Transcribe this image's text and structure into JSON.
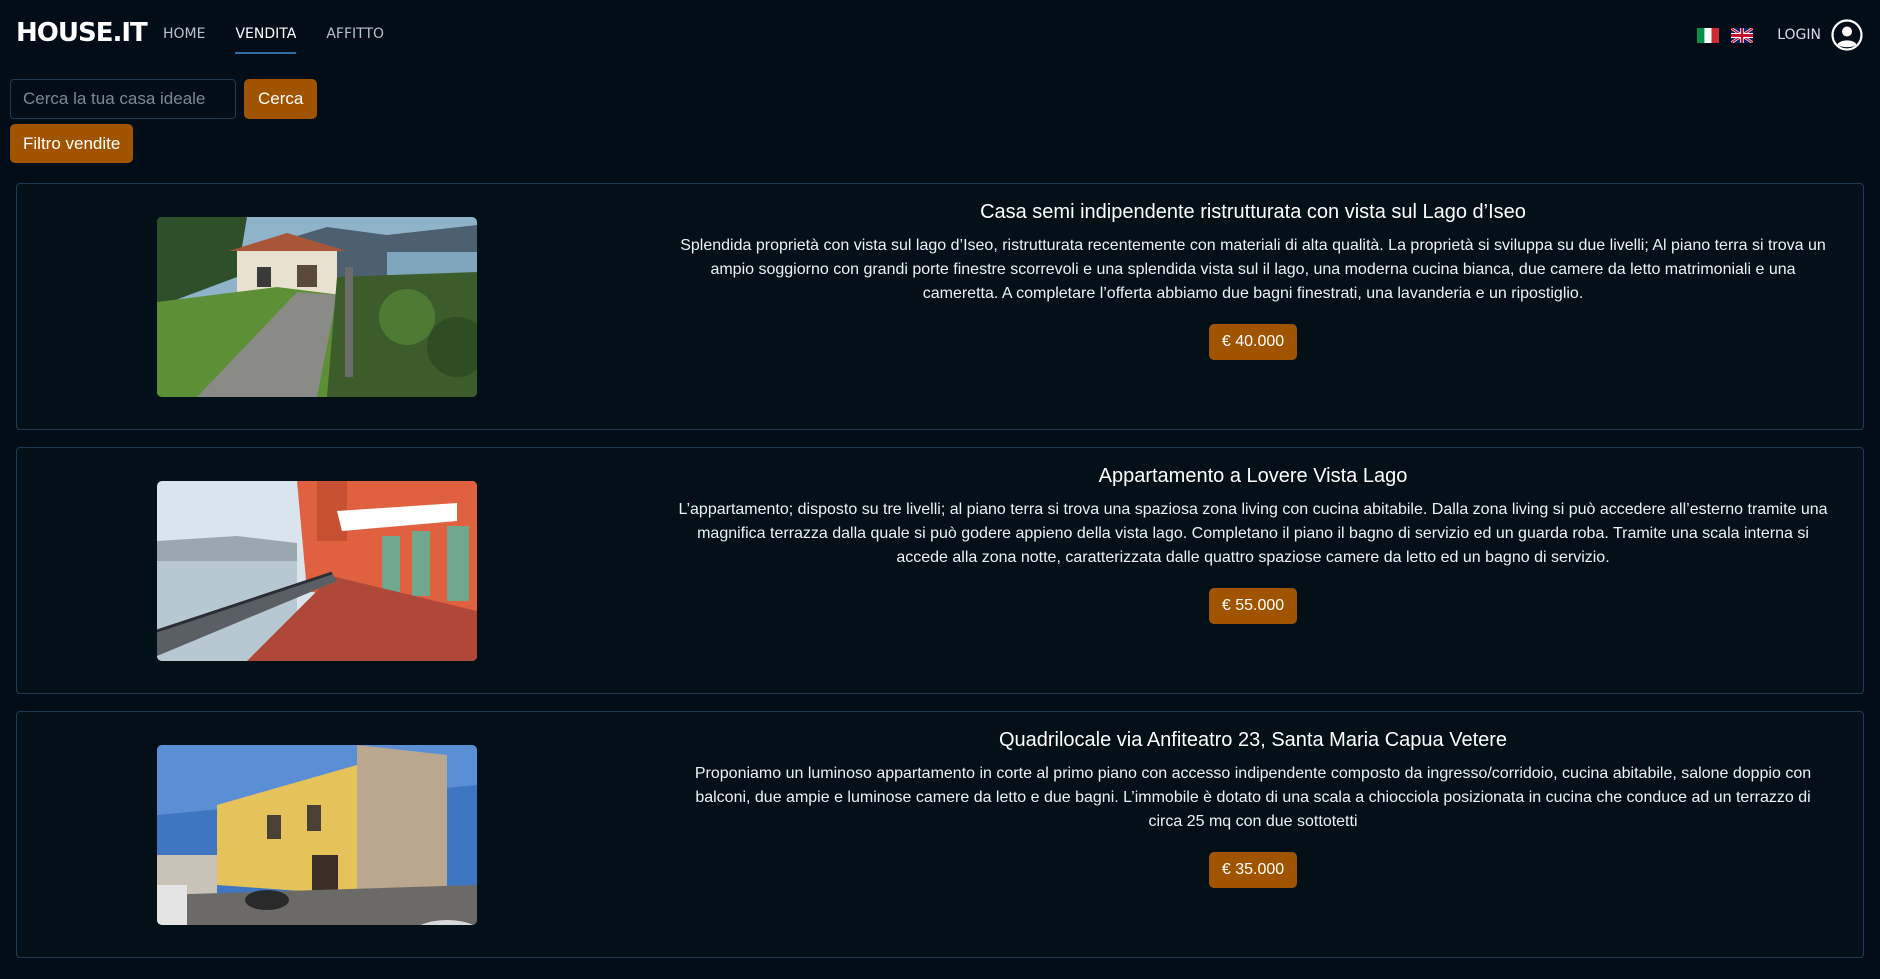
{
  "brand": "HOUSE.IT",
  "nav": {
    "items": [
      {
        "label": "HOME",
        "active": false
      },
      {
        "label": "VENDITA",
        "active": true
      },
      {
        "label": "AFFITTO",
        "active": false
      }
    ],
    "login_label": "LOGIN",
    "flags": [
      "italian-flag-icon",
      "uk-flag-icon"
    ],
    "user_icon": "user-circle-icon"
  },
  "search": {
    "placeholder": "Cerca la tua casa ideale",
    "value": "",
    "button_label": "Cerca"
  },
  "filter": {
    "button_label": "Filtro vendite"
  },
  "colors": {
    "background": "#020d17",
    "accent": "#a15400",
    "card_border": "#1c3a56"
  },
  "listings": [
    {
      "title": "Casa semi indipendente ristrutturata con vista sul Lago d’Iseo",
      "description": "Splendida proprietà con vista sul lago d’Iseo, ristrutturata recentemente con materiali di alta qualità. La proprietà si sviluppa su due livelli; Al piano terra si trova un ampio soggiorno con grandi porte finestre scorrevoli e una splendida vista sul il lago, una moderna cucina bianca, due camere da letto matrimoniali e una cameretta. A completare l’offerta abbiamo due bagni finestrati, una lavanderia e un ripostiglio.",
      "price": "€ 40.000"
    },
    {
      "title": "Appartamento a Lovere Vista Lago",
      "description": "L’appartamento; disposto su tre livelli; al piano terra si trova una spaziosa zona living con cucina abitabile. Dalla zona living si può accedere all’esterno tramite una magnifica terrazza dalla quale si può godere appieno della vista lago. Completano il piano il bagno di servizio ed un guarda roba. Tramite una scala interna si accede alla zona notte, caratterizzata dalle quattro spaziose camere da letto ed un bagno di servizio.",
      "price": "€ 55.000"
    },
    {
      "title": "Quadrilocale via Anfiteatro 23, Santa Maria Capua Vetere",
      "description": "Proponiamo un luminoso appartamento in corte al primo piano con accesso indipendente composto da ingresso/corridoio, cucina abitabile, salone doppio con balconi, due ampie e luminose camere da letto e due bagni. L’immobile è dotato di una scala a chiocciola posizionata in cucina che conduce ad un terrazzo di circa 25 mq con due sottotetti",
      "price": "€ 35.000"
    }
  ]
}
